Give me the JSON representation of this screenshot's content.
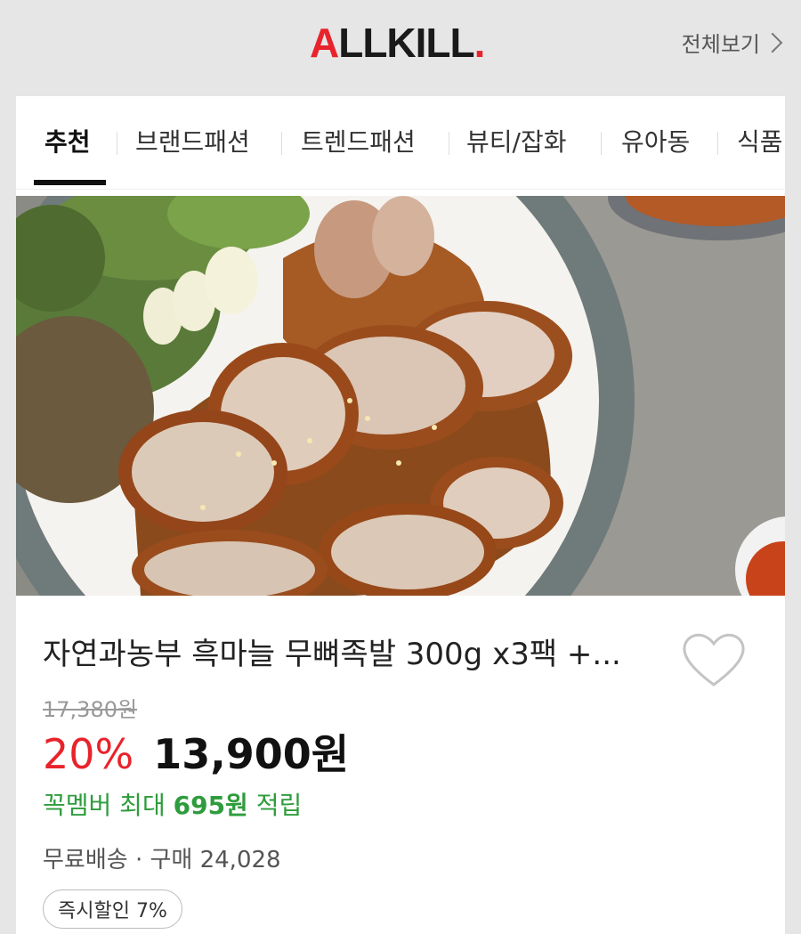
{
  "header": {
    "logo": {
      "a": "A",
      "rest": "LLKILL",
      "dot": "."
    },
    "view_all": "전체보기"
  },
  "tabs": [
    {
      "label": "추천",
      "active": true
    },
    {
      "label": "브랜드패션",
      "active": false
    },
    {
      "label": "트렌드패션",
      "active": false
    },
    {
      "label": "뷰티/잡화",
      "active": false
    },
    {
      "label": "유아동",
      "active": false
    },
    {
      "label": "식품",
      "active": false
    }
  ],
  "product": {
    "title": "자연과농부 흑마늘 무뼈족발 300g x3팩 +...",
    "original_price": "17,380원",
    "discount": "20%",
    "price": "13,900원",
    "points": {
      "prefix": "꼭멤버 최대 ",
      "amount": "695원",
      "suffix": " 적립"
    },
    "shipping": "무료배송",
    "purchase_count": "구매 24,028",
    "badge": "즉시할인 7%"
  },
  "colors": {
    "brand": "#e8232b",
    "points": "#2e9c3c"
  },
  "icons": {
    "wishlist": "heart-outline-icon",
    "view_all": "chevron-right-icon"
  }
}
